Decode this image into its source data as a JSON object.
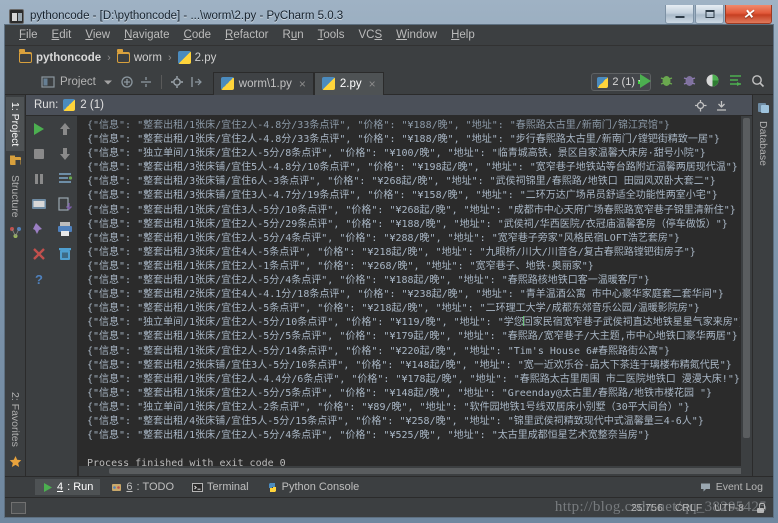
{
  "window": {
    "title": "pythoncode - [D:\\pythoncode] - ...\\worm\\2.py - PyCharm 5.0.3",
    "minimize_label": "Minimize",
    "maximize_label": "Maximize",
    "close_label": "✕"
  },
  "menu": [
    {
      "label": "File",
      "mnemonic": "F"
    },
    {
      "label": "Edit",
      "mnemonic": "E"
    },
    {
      "label": "View",
      "mnemonic": "V"
    },
    {
      "label": "Navigate",
      "mnemonic": "N"
    },
    {
      "label": "Code",
      "mnemonic": "C"
    },
    {
      "label": "Refactor",
      "mnemonic": "R"
    },
    {
      "label": "Run",
      "mnemonic": "u"
    },
    {
      "label": "Tools",
      "mnemonic": "T"
    },
    {
      "label": "VCS",
      "mnemonic": "S"
    },
    {
      "label": "Window",
      "mnemonic": "W"
    },
    {
      "label": "Help",
      "mnemonic": "H"
    }
  ],
  "breadcrumb": {
    "items": [
      "pythoncode",
      "worm",
      "2.py"
    ],
    "separator": "›"
  },
  "toolbar": {
    "project_label": "Project",
    "run_config_label": "2 (1)"
  },
  "editor_tabs": [
    {
      "label": "worm\\1.py",
      "active": false,
      "close": "×"
    },
    {
      "label": "2.py",
      "active": true,
      "close": "×"
    }
  ],
  "left_strip": [
    {
      "label": "1: Project",
      "selected": true
    },
    {
      "label": "Structure",
      "selected": false
    },
    {
      "label": "2: Favorites",
      "selected": false
    }
  ],
  "right_strip": [
    {
      "label": "Database",
      "selected": false
    }
  ],
  "run_window": {
    "title": "Run:",
    "config": "2 (1)"
  },
  "console": {
    "lines": [
      "{\"信息\": \"整套出租/1张床/宜住2人-4.8分/33条点评\", \"价格\": \"¥188/晚\", \"地址\": \"春熙路太古里/新南门/锦江宾馆\"}",
      "{\"信息\": \"整套出租/1张床/宜住2人-4.8分/33条点评\", \"价格\": \"¥188/晚\", \"地址\": \"步行春熙路太古里/新南门/镗钯街精致一居\"}",
      "{\"信息\": \"独立单间/1张床/宜住2人-5分/8条点评\", \"价格\": \"¥100/晚\", \"地址\": \"临青城高铁，景区自家温馨大床房·甜号小院\"}",
      "{\"信息\": \"整套出租/3张床铺/宜住5人-4.8分/10条点评\", \"价格\": \"¥198起/晚\", \"地址\": \"宽窄巷子地铁站等台路附近温馨两居现代温\"}",
      "{\"信息\": \"整套出租/3张床铺/宜住6人-3条点评\", \"价格\": \"¥268起/晚\", \"地址\": \"武侯祠锦里/春熙路/地铁口 田园风双卧大套二\"}",
      "{\"信息\": \"整套出租/3张床铺/宜住3人-4.7分/19条点评\", \"价格\": \"¥158/晚\", \"地址\": \"二环万达广场吊员舒适全功能性两室小宅\"}",
      "{\"信息\": \"整套出租/1张床/宜住3人-5分/10条点评\", \"价格\": \"¥268起/晚\", \"地址\": \"成都市中心天府广场春熙路宽窄巷子锦里清新住\"}",
      "{\"信息\": \"整套出租/1张床/宜住2人-5分/29条点评\", \"价格\": \"¥188/晚\", \"地址\": \"武侯祠/华西医院/衣冠庙温馨客房（停车做饭）\"}",
      "{\"信息\": \"整套出租/1张床/宜住2人-5分/4条点评\", \"价格\": \"¥288/晚\", \"地址\": \"宽窄巷子旁家\"风格民宿LOFT浩艺套房\"}",
      "{\"信息\": \"整套出租/3张床/宜住4人-5条点评\", \"价格\": \"¥218起/晚\", \"地址\": \"九眼桥/川大/川音各/复古春熙路镗钯街房子\"}",
      "{\"信息\": \"整套出租/1张床/宜住2人-1条点评\", \"价格\": \"¥268/晚\", \"地址\": \"宽窄巷子、地铁·奥丽家\"}",
      "{\"信息\": \"整套出租/1张床/宜住2人-5分/4条点评\", \"价格\": \"¥188起/晚\", \"地址\": \"春熙路核地铁口客一温暖客厅\"}",
      "{\"信息\": \"整套出租/2张床/宜住4人-4.1分/18条点评\", \"价格\": \"¥238起/晚\", \"地址\": \"青羊温酒公寓 市中心豪华家庭套二套华间\"}",
      "{\"信息\": \"整套出租/1张床/宜住2人-5条点评\", \"价格\": \"¥218起/晚\", \"地址\": \"二环理工大学/成都东郊音乐公园/温暖影院房\"}",
      "{\"信息\": \"独立单间/1张床/宜住2人-5分/10条点评\", \"价格\": \"¥119/晚\", \"地址\": \"学您回家民宿宽窄巷子武侯祠直达地铁星星气家来房\"}",
      "{\"信息\": \"整套出租/1张床/宜住2人-5分/5条点评\", \"价格\": \"¥179起/晚\", \"地址\": \"春熙路/宽窄巷子/大主题,市中心地铁口豪华两居\"}",
      "{\"信息\": \"整套出租/1张床/宜住2人-5分/14条点评\", \"价格\": \"¥220起/晚\", \"地址\": \"Tim's House 6#春熙路街公寓\"}",
      "{\"信息\": \"整套出租/2张床铺/宜住3人-5分/10条点评\", \"价格\": \"¥148起/晚\", \"地址\": \"宽一近欢乐谷-品大下茶连于璃楼布精氮代民\"}",
      "{\"信息\": \"整套出租/1张床/宜住2人-4.4分/6条点评\", \"价格\": \"¥178起/晚\", \"地址\": \"春熙路太古里周围 市二医院地铁口 漫漫大床!\"}",
      "{\"信息\": \"整套出租/1张床/宜住2人-5分/5条点评\", \"价格\": \"¥148起/晚\", \"地址\": \"Greenday@太古里/春熙路/地铁市楼花园 \"}",
      "{\"信息\": \"独立单间/1张床/宜住2人-2条点评\", \"价格\": \"¥89/晚\", \"地址\": \"软件园地铁1号线双居床小别墅（30平大间台）\"}",
      "{\"信息\": \"整套出租/4张床铺/宜住5人-5分/15条点评\", \"价格\": \"¥258/晚\", \"地址\": \"锦里武侯祠精致现代中式温馨量三4-6人\"}",
      "{\"信息\": \"整套出租/1张床/宜住2人-5分/4条点评\", \"价格\": \"¥525/晚\", \"地址\": \"太古里成都恒星艺术宽整奈当房\"}"
    ],
    "process_finished": "Process finished with exit code 0"
  },
  "bottom_tabs": [
    {
      "num": "4",
      "label": ": Run",
      "selected": true,
      "icon": "run-icon"
    },
    {
      "num": "6",
      "label": ": TODO",
      "selected": false,
      "icon": "todo-icon"
    },
    {
      "num": "",
      "label": "Terminal",
      "selected": false,
      "icon": "terminal-icon"
    },
    {
      "num": "",
      "label": "Python Console",
      "selected": false,
      "icon": "python-icon"
    }
  ],
  "event_log": {
    "label": "Event Log"
  },
  "status_bar": {
    "caret_position": "25:756",
    "line_separator": "CRLF",
    "encoding": "UTF-8",
    "lock": "lock-icon"
  },
  "watermark": {
    "text": "http://blog.csdn.net/qq_38295425"
  },
  "colors": {
    "accent_green": "#4caf50",
    "console_bg": "#2b2b2b",
    "console_fg": "#a9b7c6",
    "panel_bg": "#3c3f41",
    "selected_tab": "#4e5254"
  }
}
